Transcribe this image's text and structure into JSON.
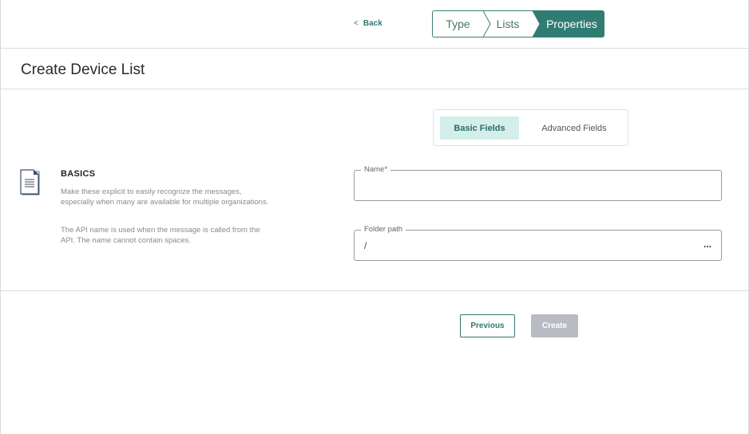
{
  "topbar": {
    "back_label": "Back",
    "steps": [
      {
        "label": "Type",
        "state": "completed"
      },
      {
        "label": "Lists",
        "state": "completed"
      },
      {
        "label": "Properties",
        "state": "active"
      }
    ]
  },
  "header": {
    "title": "Create Device List"
  },
  "tabs": {
    "basic": "Basic Fields",
    "advanced": "Advanced Fields",
    "selected": "Basic Fields"
  },
  "basics": {
    "title": "BASICS",
    "description_1": "Make these explicit to easily recognize the messages, especially when many are available for multiple organizations.",
    "description_2": "The API name is used when the message is called from the API. The name cannot contain spaces."
  },
  "fields": {
    "name_label": "Name*",
    "name_value": "",
    "folder_label": "Folder path",
    "folder_value": "/",
    "folder_browse": "..."
  },
  "footer": {
    "previous_label": "Previous",
    "create_label": "Create"
  },
  "colors": {
    "accent": "#2f7d72",
    "tab_selected_bg": "#d4efeb",
    "disabled_button": "#b8bcc2"
  }
}
